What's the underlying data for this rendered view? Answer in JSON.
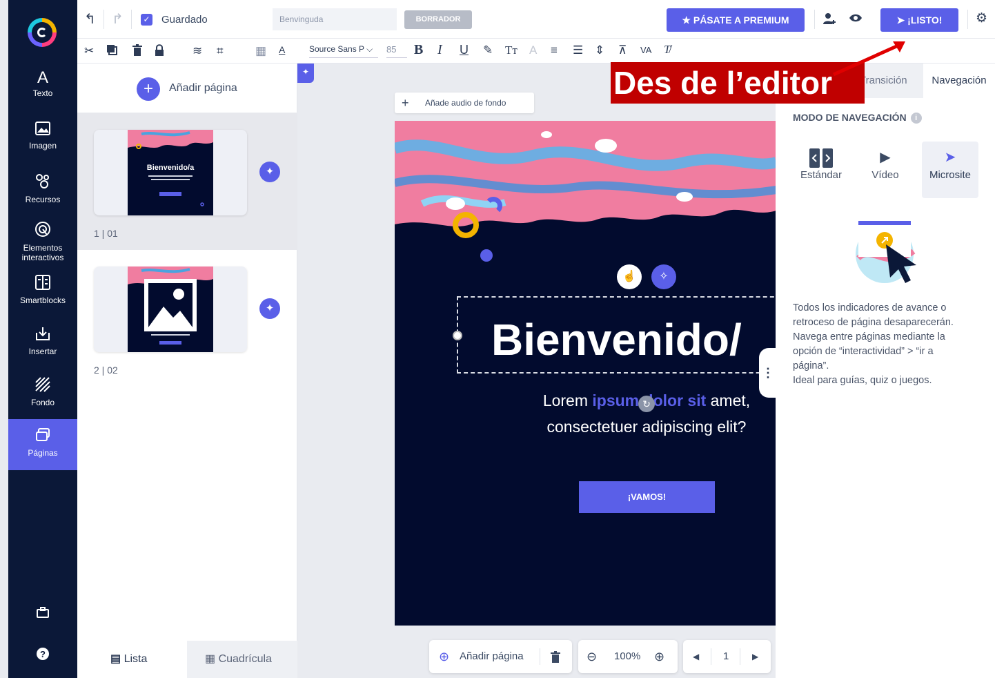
{
  "sidebar": {
    "items": [
      {
        "label": "Texto",
        "icon": "text-icon"
      },
      {
        "label": "Imagen",
        "icon": "image-icon"
      },
      {
        "label": "Recursos",
        "icon": "resources-icon"
      },
      {
        "label": "Elementos interactivos",
        "icon": "interactive-icon"
      },
      {
        "label": "Smartblocks",
        "icon": "smartblocks-icon"
      },
      {
        "label": "Insertar",
        "icon": "insert-icon"
      },
      {
        "label": "Fondo",
        "icon": "background-icon"
      },
      {
        "label": "Páginas",
        "icon": "pages-icon",
        "active": true
      }
    ]
  },
  "toolbar": {
    "saved_label": "Guardado",
    "title_value": "Benvinguda",
    "draft_label": "BORRADOR",
    "premium_label": "PÁSATE A PREMIUM",
    "ready_label": "¡LISTO!",
    "font_family": "Source Sans P",
    "font_size": "85"
  },
  "pages_panel": {
    "add_page_label": "Añadir página",
    "pages": [
      {
        "number": "1 | 01",
        "thumb_title": "Bienvenido/a",
        "selected": true
      },
      {
        "number": "2 | 02",
        "thumb_title": "",
        "selected": false
      }
    ],
    "view_list_label": "Lista",
    "view_grid_label": "Cuadrícula"
  },
  "canvas": {
    "audio_label": "Añade audio de fondo",
    "title": "Bienvenido/",
    "subtitle_plain_1": "Lorem ",
    "subtitle_hl": "ipsum dolor sit",
    "subtitle_plain_2": " amet,",
    "subtitle_line2": "consectetuer adipiscing elit?",
    "cta_label": "¡VAMOS!"
  },
  "bottom_controls": {
    "add_page_label": "Añadir página",
    "zoom": "100%",
    "page": "1"
  },
  "right_panel": {
    "tab_transition": "Transición",
    "tab_navigation": "Navegación",
    "heading": "MODO DE NAVEGACIÓN",
    "modes": [
      {
        "label": "Estándar",
        "icon": "standard-icon"
      },
      {
        "label": "Vídeo",
        "icon": "play-icon"
      },
      {
        "label": "Microsite",
        "icon": "cursor-icon",
        "active": true
      }
    ],
    "description": [
      "Todos los indicadores de avance o",
      "retroceso de página desaparecerán.",
      "Navega entre páginas mediante la",
      "opción de “interactividad” > “ir a",
      "página”.",
      "Ideal para guías, quiz o juegos."
    ]
  },
  "annotation": {
    "text": "Des de l’editor",
    "color": "#c00000"
  },
  "colors": {
    "accent": "#5a5fe8",
    "sidebar": "#0b1838",
    "canvas_bg": "#020b2e"
  }
}
